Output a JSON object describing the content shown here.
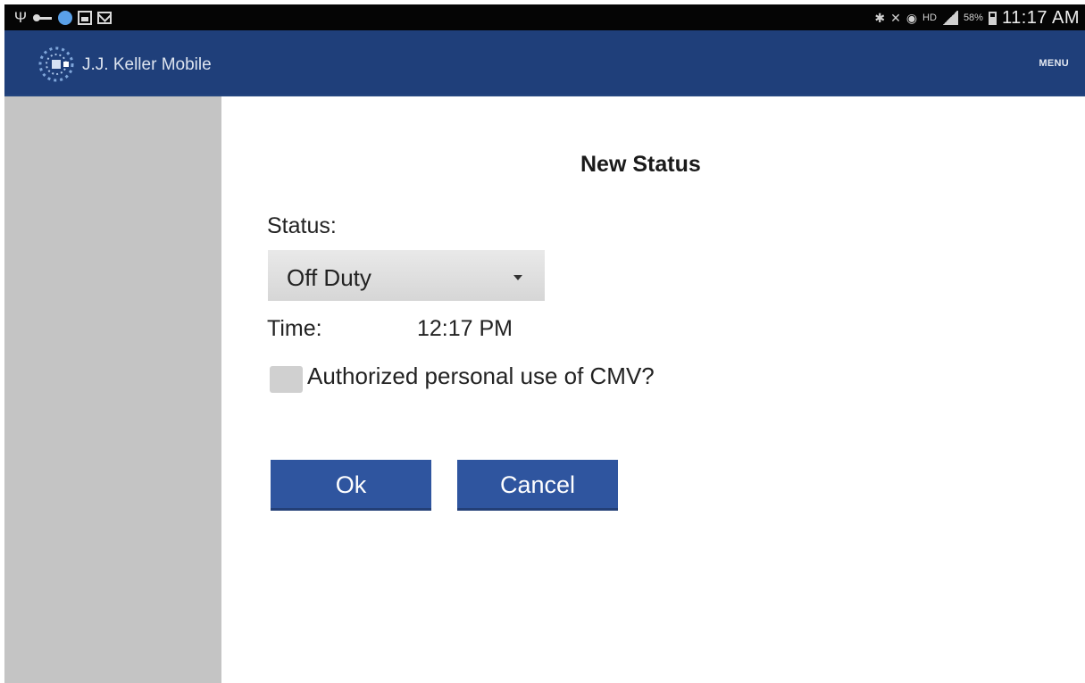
{
  "status_bar": {
    "time": "11:17 AM",
    "battery_percent": "58%",
    "network_label": "HD"
  },
  "app_bar": {
    "title": "J.J. Keller Mobile",
    "menu_label": "MENU"
  },
  "dialog": {
    "title": "New Status",
    "status_label": "Status:",
    "status_value": "Off Duty",
    "time_label": "Time:",
    "time_value": "12:17 PM",
    "personal_use_label": "Authorized personal use of CMV?",
    "personal_use_checked": false,
    "ok_label": "Ok",
    "cancel_label": "Cancel"
  },
  "colors": {
    "app_bar": "#1f3f7a",
    "button": "#2f559f",
    "sidebar": "#c4c4c4"
  }
}
